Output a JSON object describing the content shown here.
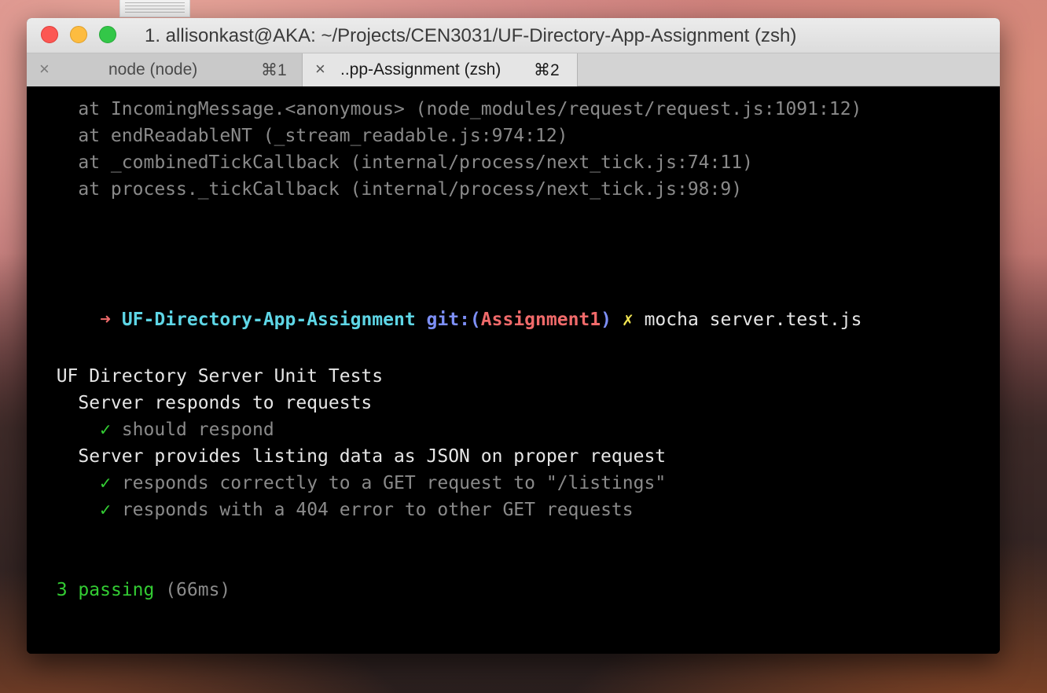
{
  "window": {
    "title": "1. allisonkast@AKA: ~/Projects/CEN3031/UF-Directory-App-Assignment (zsh)"
  },
  "tabs": [
    {
      "label": "node (node)",
      "shortcut": "⌘1",
      "active": false
    },
    {
      "label": "..pp-Assignment (zsh)",
      "shortcut": "⌘2",
      "active": true
    }
  ],
  "icons": {
    "tab_close": "×",
    "prompt_arrow": "➜",
    "dirty_mark": "✗",
    "check": "✓"
  },
  "colors": {
    "prompt_arrow_error": "#ee6a6a",
    "prompt_arrow_ok": "#5ee07a",
    "directory": "#5ed6e6",
    "git": "#7d8ff7",
    "branch": "#f06a6a",
    "dirty": "#f2e653",
    "pass": "#33cc33"
  },
  "terminal": {
    "stack": [
      "    at IncomingMessage.<anonymous> (node_modules/request/request.js:1091:12)",
      "    at endReadableNT (_stream_readable.js:974:12)",
      "    at _combinedTickCallback (internal/process/next_tick.js:74:11)",
      "    at process._tickCallback (internal/process/next_tick.js:98:9)"
    ],
    "prompt": {
      "directory": "UF-Directory-App-Assignment",
      "git_prefix": "git:(",
      "branch": "Assignment1",
      "git_suffix": ")",
      "command": "mocha server.test.js"
    },
    "suite": "  UF Directory Server Unit Tests",
    "group1": "    Server responds to requests",
    "test1": "should respond",
    "group2": "    Server provides listing data as JSON on proper request",
    "test2": "responds correctly to a GET request to \"/listings\"",
    "test3": "responds with a 404 error to other GET requests",
    "passing": "3 passing",
    "duration": "(66ms)"
  }
}
